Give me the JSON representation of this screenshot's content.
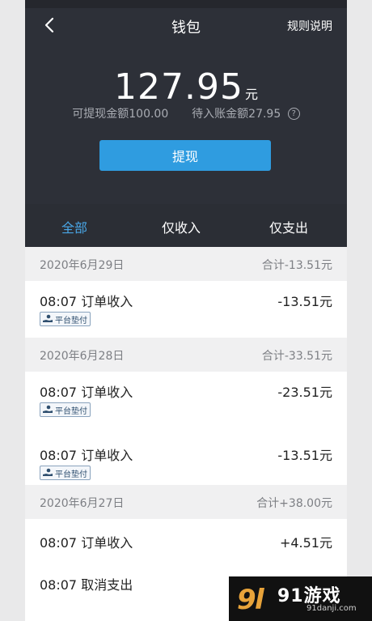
{
  "header": {
    "title": "钱包",
    "rules_label": "规则说明"
  },
  "balance": {
    "amount": "127.95",
    "unit": "元",
    "withdrawable": "可提现金额100.00",
    "pending": "待入账金额27.95"
  },
  "actions": {
    "withdraw_label": "提现"
  },
  "tabs": [
    {
      "label": "全部",
      "active": true
    },
    {
      "label": "仅收入",
      "active": false
    },
    {
      "label": "仅支出",
      "active": false
    }
  ],
  "groups": [
    {
      "date": "2020年6月29日",
      "total": "合计-13.51元",
      "entries": [
        {
          "title": "08:07  订单收入",
          "amount": "-13.51元",
          "tag": "平台垫付"
        }
      ]
    },
    {
      "date": "2020年6月28日",
      "total": "合计-33.51元",
      "entries": [
        {
          "title": "08:07  订单收入",
          "amount": "-23.51元",
          "tag": "平台垫付"
        },
        {
          "title": "08:07  订单收入",
          "amount": "-13.51元",
          "tag": "平台垫付"
        }
      ]
    },
    {
      "date": "2020年6月27日",
      "total": "合计+38.00元",
      "entries": [
        {
          "title": "08:07  订单收入",
          "amount": "+4.51元",
          "tag": ""
        },
        {
          "title": "08:07  取消支出",
          "amount": "",
          "tag": ""
        }
      ]
    }
  ],
  "watermark": {
    "text": "91游戏",
    "url": "91danji.com"
  },
  "colors": {
    "header_bg": "#2d3038",
    "accent": "#2f9ce0",
    "tab_active": "#49a6e6"
  }
}
